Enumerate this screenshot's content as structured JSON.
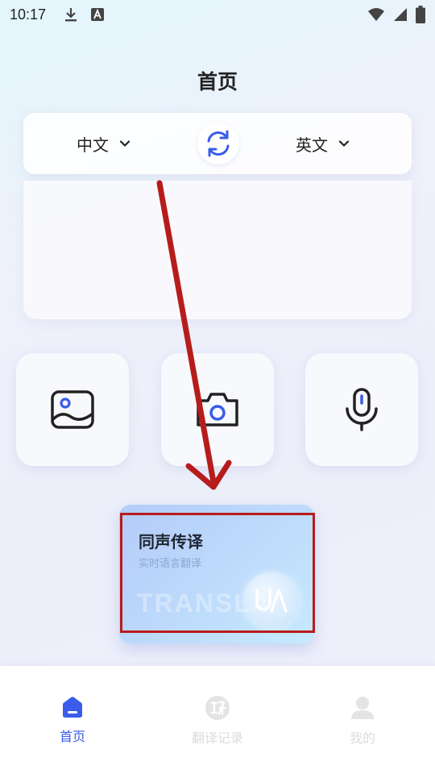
{
  "status_bar": {
    "time": "10:17",
    "icons_left": [
      "download-icon",
      "a-notification-icon"
    ],
    "icons_right": [
      "wifi-icon",
      "signal-icon",
      "battery-icon"
    ]
  },
  "page": {
    "title": "首页"
  },
  "language_bar": {
    "source_lang": "中文",
    "target_lang": "英文",
    "swap_icon": "swap-icon"
  },
  "text_input": {
    "value": ""
  },
  "features": [
    {
      "name": "image-translate",
      "icon": "image-icon"
    },
    {
      "name": "camera-translate",
      "icon": "camera-icon"
    },
    {
      "name": "voice-translate",
      "icon": "microphone-icon"
    }
  ],
  "simultaneous_card": {
    "title": "同声传译",
    "subtitle": "实时语言翻译",
    "watermark": "TRANSLA"
  },
  "bottom_nav": {
    "items": [
      {
        "label": "首页",
        "icon": "home-icon",
        "active": true
      },
      {
        "label": "翻译记录",
        "icon": "translate-record-icon",
        "active": false
      },
      {
        "label": "我的",
        "icon": "user-icon",
        "active": false
      }
    ]
  },
  "colors": {
    "accent": "#3a5ce9",
    "annotation": "#b71c1c"
  }
}
